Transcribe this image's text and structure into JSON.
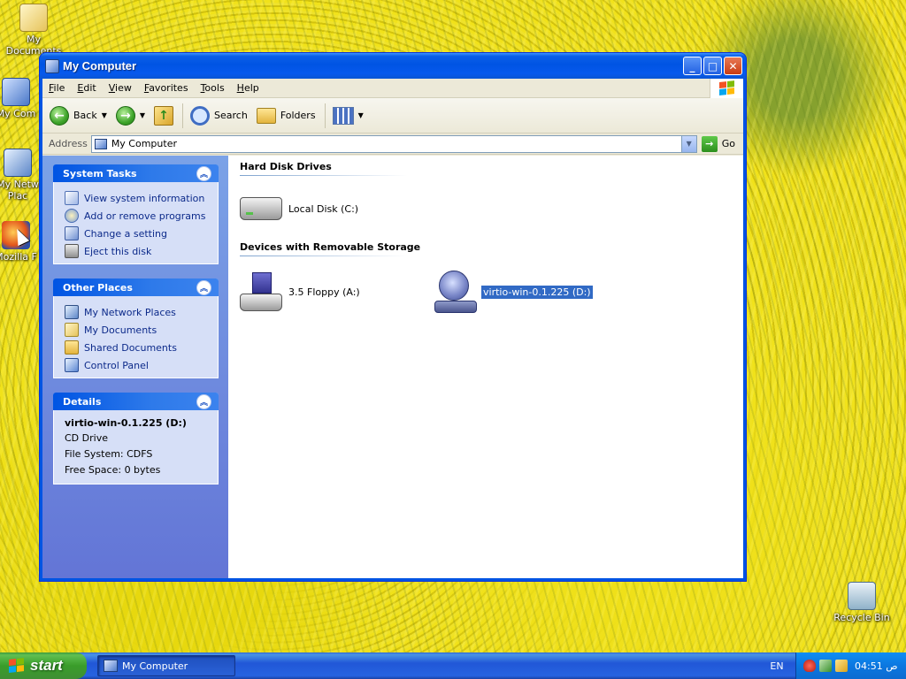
{
  "desktop": {
    "icons": [
      {
        "label": "My Documents",
        "icon": "my-documents-icon"
      },
      {
        "label": "My Com",
        "icon": "my-computer-icon"
      },
      {
        "label": "My Netw Plac",
        "icon": "network-places-icon"
      },
      {
        "label": "Mozilla F",
        "icon": "firefox-icon"
      },
      {
        "label": "Recycle Bin",
        "icon": "recycle-bin-icon"
      }
    ]
  },
  "window": {
    "title": "My Computer",
    "menu": [
      "File",
      "Edit",
      "View",
      "Favorites",
      "Tools",
      "Help"
    ],
    "toolbar": {
      "back_label": "Back",
      "search_label": "Search",
      "folders_label": "Folders"
    },
    "address": {
      "label": "Address",
      "value": "My Computer",
      "go_label": "Go"
    },
    "task_pane": {
      "system_tasks": {
        "title": "System Tasks",
        "items": [
          "View system information",
          "Add or remove programs",
          "Change a setting",
          "Eject this disk"
        ]
      },
      "other_places": {
        "title": "Other Places",
        "items": [
          "My Network Places",
          "My Documents",
          "Shared Documents",
          "Control Panel"
        ]
      },
      "details": {
        "title": "Details",
        "name": "virtio-win-0.1.225 (D:)",
        "type": "CD Drive",
        "file_system": "File System: CDFS",
        "free_space": "Free Space: 0 bytes"
      }
    },
    "content": {
      "groups": [
        {
          "title": "Hard Disk Drives",
          "drives": [
            {
              "label": "Local Disk (C:)",
              "icon": "hard-disk-icon"
            }
          ]
        },
        {
          "title": "Devices with Removable Storage",
          "drives": [
            {
              "label": "3.5 Floppy (A:)",
              "icon": "floppy-drive-icon"
            },
            {
              "label": "virtio-win-0.1.225 (D:)",
              "icon": "cd-drive-icon",
              "selected": true
            }
          ]
        }
      ]
    }
  },
  "taskbar": {
    "start_label": "start",
    "task_item": "My Computer",
    "language": "EN",
    "clock": "04:51 ص"
  },
  "colors": {
    "title_blue": "#0054e3",
    "taskpane_blue": "#6375d6",
    "selection": "#316ac5",
    "start_green": "#3a9d2a"
  }
}
